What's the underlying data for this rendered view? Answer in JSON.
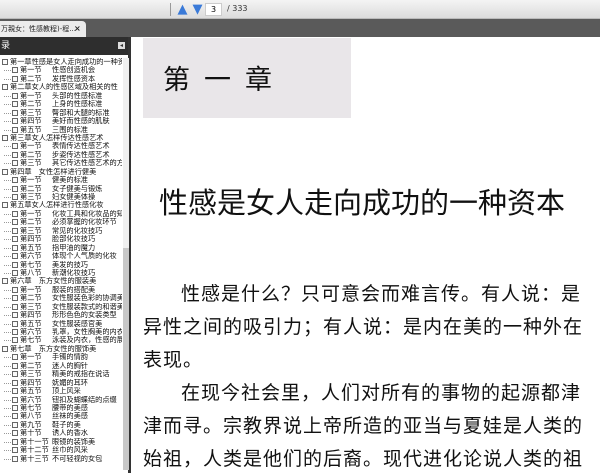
{
  "toolbar": {
    "page": "3",
    "total": "/ 333",
    "prev_icon": "arrow-up-icon",
    "next_icon": "arrow-down-icon"
  },
  "tab": {
    "label": "万親女：性感教程)-程...",
    "close": "×"
  },
  "sidebar": {
    "title": "录",
    "collapse": "◂",
    "items": [
      {
        "t": "ch",
        "l": "第一章性感是女人走向成功的一种资本"
      },
      {
        "t": "sec",
        "n": "第一节",
        "l": "性感创造机会"
      },
      {
        "t": "sec",
        "n": "第二节",
        "l": "发挥性感资本"
      },
      {
        "t": "ch",
        "l": "第二章女人的性感区域及相关的性"
      },
      {
        "t": "sec",
        "n": "第一节",
        "l": "头部的性感标准"
      },
      {
        "t": "sec",
        "n": "第二节",
        "l": "上身的性感标准"
      },
      {
        "t": "sec",
        "n": "第三节",
        "l": "臀部和大腿的标准"
      },
      {
        "t": "sec",
        "n": "第四节",
        "l": "美好而性感的肌肤"
      },
      {
        "t": "sec",
        "n": "第五节",
        "l": "三围的标准"
      },
      {
        "t": "ch",
        "l": "第三章女人怎样传达性感艺术"
      },
      {
        "t": "sec",
        "n": "第一节",
        "l": "表情传达性感艺术"
      },
      {
        "t": "sec",
        "n": "第二节",
        "l": "步姿传达性感艺术"
      },
      {
        "t": "sec",
        "n": "第三节",
        "l": "其它传达性感艺术的方"
      },
      {
        "t": "ch",
        "l": "第四章　女性怎样进行健美"
      },
      {
        "t": "sec",
        "n": "第一节",
        "l": "健美的标准"
      },
      {
        "t": "sec",
        "n": "第二节",
        "l": "女子健美与锻炼"
      },
      {
        "t": "sec",
        "n": "第三节",
        "l": "妇女健美体操"
      },
      {
        "t": "ch",
        "l": "第五章女人怎样进行性感化妆"
      },
      {
        "t": "sec",
        "n": "第一节",
        "l": "化妆工具和化妆品的知"
      },
      {
        "t": "sec",
        "n": "第二节",
        "l": "必须掌握的化妆环节"
      },
      {
        "t": "sec",
        "n": "第三节",
        "l": "常见的化妆技巧"
      },
      {
        "t": "sec",
        "n": "第四节",
        "l": "脸部化妆技巧"
      },
      {
        "t": "sec",
        "n": "第五节",
        "l": "指甲油的魔力"
      },
      {
        "t": "sec",
        "n": "第六节",
        "l": "体现个人气质的化妆"
      },
      {
        "t": "sec",
        "n": "第七节",
        "l": "美发的技巧"
      },
      {
        "t": "sec",
        "n": "第八节",
        "l": "新潮化妆技巧"
      },
      {
        "t": "ch",
        "l": "第六章　东方女性的服装美"
      },
      {
        "t": "sec",
        "n": "第一节",
        "l": "服装的搭配美"
      },
      {
        "t": "sec",
        "n": "第二节",
        "l": "女性服装色彩的协调美"
      },
      {
        "t": "sec",
        "n": "第三节",
        "l": "女性服装款式的和谐美"
      },
      {
        "t": "sec",
        "n": "第四节",
        "l": "形形色色的女装类型"
      },
      {
        "t": "sec",
        "n": "第五节",
        "l": "女性服装感官美"
      },
      {
        "t": "sec",
        "n": "第六节",
        "l": "乳罩，女性胸美的内衣"
      },
      {
        "t": "sec",
        "n": "第七节",
        "l": "泳装及内衣，性感的展"
      },
      {
        "t": "ch",
        "l": "第七章　东方女性的服饰美"
      },
      {
        "t": "sec",
        "n": "第一节",
        "l": "手镯的情韵"
      },
      {
        "t": "sec",
        "n": "第二节",
        "l": "迷人的胸针"
      },
      {
        "t": "sec",
        "n": "第三节",
        "l": "精美的戒指在说话"
      },
      {
        "t": "sec",
        "n": "第四节",
        "l": "妩媚的耳环"
      },
      {
        "t": "sec",
        "n": "第五节",
        "l": "顶上风采"
      },
      {
        "t": "sec",
        "n": "第六节",
        "l": "钮扣及蝴蝶结的点缀"
      },
      {
        "t": "sec",
        "n": "第七节",
        "l": "腰带的美感"
      },
      {
        "t": "sec",
        "n": "第八节",
        "l": "丝袜的美感"
      },
      {
        "t": "sec",
        "n": "第九节",
        "l": "鞋子的美"
      },
      {
        "t": "sec",
        "n": "第十节",
        "l": "诱人的香水"
      },
      {
        "t": "sec",
        "n": "第十一节",
        "l": "眼镜的装饰美"
      },
      {
        "t": "sec",
        "n": "第十二节",
        "l": "丝巾的风采"
      },
      {
        "t": "sec",
        "n": "第十三节",
        "l": "不可轻视的女包"
      }
    ]
  },
  "page": {
    "chapter": "第一章",
    "title": "性感是女人走向成功的一种资本",
    "paragraphs": [
      "性感是什么？只可意会而难言传。有人说：是异性之间的吸引力；有人说：是内在美的一种外在表现。",
      "在现今社会里，人们对所有的事物的起源都津津而寻。宗教界说上帝所造的亚当与夏娃是人类的始祖，人类是他们的后裔。现代进化论说人类的祖"
    ]
  }
}
